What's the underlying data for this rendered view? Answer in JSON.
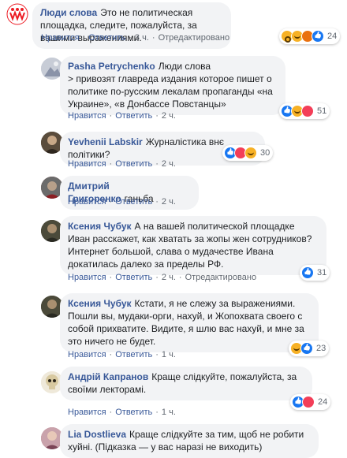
{
  "labels": {
    "like": "Нравится",
    "reply": "Ответить",
    "edited": "Отредактировано"
  },
  "comments": [
    {
      "author": "Люди слова",
      "text": "Это не политическая площадка, следите, пожалуйста, за вашими выражениями.",
      "time": "3 ч.",
      "edited": true,
      "reactions": [
        "wow",
        "haha",
        "angry",
        "like"
      ],
      "reaction_count": "24",
      "avatar_color": "#ed1c24"
    },
    {
      "author": "Pasha Petrychenko",
      "text": "Люди слова\n> привозят главреда издания которое пишет о политике по-русским лекалам пропаганды «на Украине», «в Донбассе Повстанцы»",
      "time": "2 ч.",
      "edited": false,
      "reactions": [
        "like",
        "haha",
        "love"
      ],
      "reaction_count": "51",
      "avatar_color": "#8a93a8"
    },
    {
      "author": "Yevhenii Labskir",
      "text": "Журналістика внє політики?",
      "time": "2 ч.",
      "edited": false,
      "reactions": [
        "like",
        "love",
        "haha"
      ],
      "reaction_count": "30",
      "avatar_color": "#4a3f33"
    },
    {
      "author": "Дмитрий Григоренко",
      "text": "ганьба",
      "time": "2 ч.",
      "edited": false,
      "reactions": [],
      "reaction_count": "",
      "avatar_color": "#7a2f30"
    },
    {
      "author": "Ксения Чубук",
      "text": "А на вашей политической площадке Иван расскажет, как хватать за жопы жен сотрудников? Интернет большой, слава о мудачестве Ивана докатилась далеко за пределы РФ.",
      "time": "2 ч.",
      "edited": true,
      "reactions": [
        "like"
      ],
      "reaction_count": "31",
      "avatar_color": "#3d3a2f"
    },
    {
      "author": "Ксения Чубук",
      "text": "Кстати, я не слежу за выражениями. Пошли вы, мудаки-орги, нахуй, и Жопохвата своего с собой прихватите. Видите, я шлю вас нахуй, и мне за это ничего не будет.",
      "time": "1 ч.",
      "edited": false,
      "reactions": [
        "haha",
        "like"
      ],
      "reaction_count": "23",
      "avatar_color": "#3d3a2f"
    },
    {
      "author": "Андрій Капранов",
      "text": "Краще слідкуйте, пожалуйста, за своїми лекторамі.",
      "time": "1 ч.",
      "edited": false,
      "reactions": [
        "like",
        "love"
      ],
      "reaction_count": "24",
      "avatar_color": "#c9b48a"
    },
    {
      "author": "Lia Dostlieva",
      "text": "Краще слідкуйте за тим, щоб не робити хуйні. (Підказка — у вас наразі не виходить)",
      "time": "",
      "edited": false,
      "reactions": [],
      "reaction_count": "",
      "avatar_color": "#b07c88"
    }
  ]
}
